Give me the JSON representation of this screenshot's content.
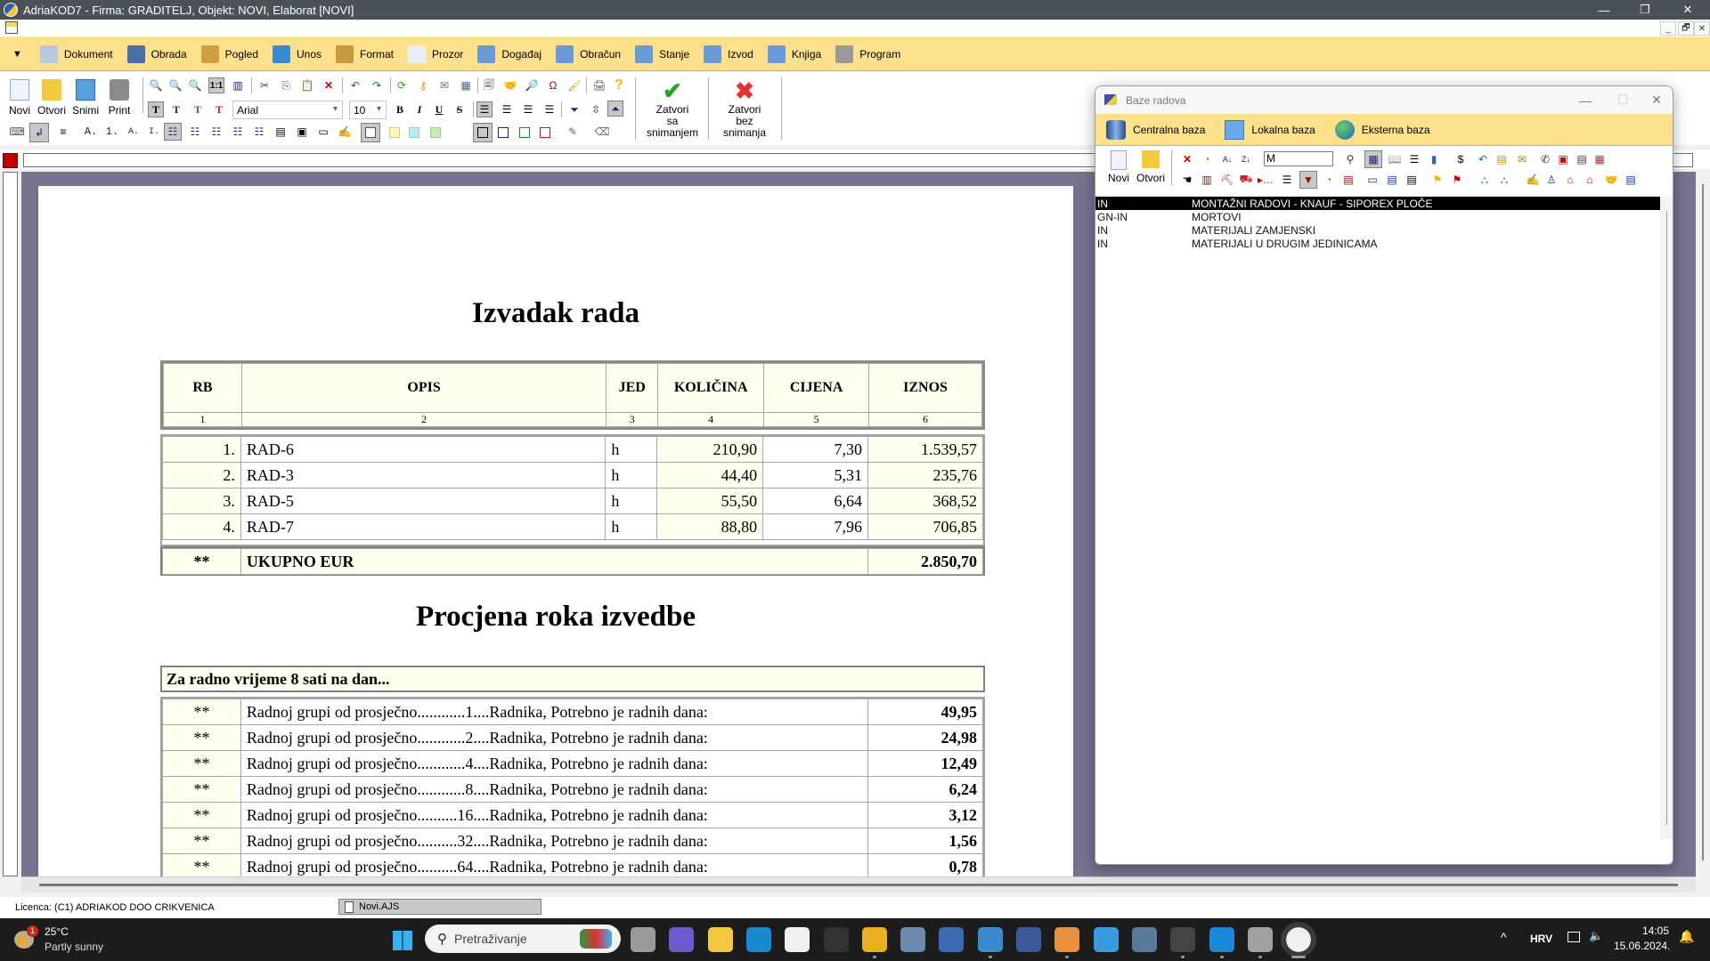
{
  "window": {
    "title": "AdriaKOD7 - Firma: GRADITELJ,   Objekt: NOVI,  Elaborat [NOVI]",
    "minimize": "—",
    "restore": "❐",
    "close": "✕",
    "mdi_min": "_",
    "mdi_restore": "🗗",
    "mdi_close": "✕"
  },
  "menu": {
    "dropdown": "▼",
    "items": [
      {
        "label": "Dokument",
        "icon": "document-icon",
        "color": "#b8c8e0"
      },
      {
        "label": "Obrada",
        "icon": "tools-icon",
        "color": "#4a6fa5"
      },
      {
        "label": "Pogled",
        "icon": "magnifier-icon",
        "color": "#d0a040"
      },
      {
        "label": "Unos",
        "icon": "arrow-icon",
        "color": "#3a8ad0"
      },
      {
        "label": "Format",
        "icon": "brush-icon",
        "color": "#c89a40"
      },
      {
        "label": "Prozor",
        "icon": "window-icon",
        "color": "#e8eef8"
      },
      {
        "label": "Događaj",
        "icon": "grid-icon",
        "color": "#6a9ad8"
      },
      {
        "label": "Obračun",
        "icon": "grid-icon",
        "color": "#6a9ad8"
      },
      {
        "label": "Stanje",
        "icon": "grid-icon",
        "color": "#6a9ad8"
      },
      {
        "label": "Izvod",
        "icon": "grid-icon",
        "color": "#6a9ad8"
      },
      {
        "label": "Knjiga",
        "icon": "grid-icon",
        "color": "#6a9ad8"
      },
      {
        "label": "Program",
        "icon": "gear-icon",
        "color": "#9a9a9a"
      }
    ]
  },
  "toolbar": {
    "novi": "Novi",
    "otvori": "Otvori",
    "snimi": "Snimi",
    "print": "Print",
    "zoom_1_1": "1:1",
    "font_name": "Arial",
    "font_size": "10",
    "bold": "B",
    "italic": "I",
    "underline": "U",
    "strike": "S",
    "t_label": "T",
    "save_close_line1": "Zatvori",
    "save_close_line2": "sa snimanjem",
    "nosave_close_line1": "Zatvori",
    "nosave_close_line2": "bez snimanja",
    "check_glyph": "✔",
    "x_glyph": "✖",
    "list_labels": [
      "A.",
      "1.",
      "A.",
      "I."
    ]
  },
  "document": {
    "title1": "Izvadak rada",
    "table1": {
      "headers": [
        "RB",
        "OPIS",
        "JED",
        "KOLIČINA",
        "CIJENA",
        "IZNOS"
      ],
      "col_numbers": [
        "1",
        "2",
        "3",
        "4",
        "5",
        "6"
      ],
      "rows": [
        {
          "rb": "1.",
          "opis": "RAD-6",
          "jed": "h",
          "kolicina": "210,90",
          "cijena": "7,30",
          "iznos": "1.539,57"
        },
        {
          "rb": "2.",
          "opis": "RAD-3",
          "jed": "h",
          "kolicina": "44,40",
          "cijena": "5,31",
          "iznos": "235,76"
        },
        {
          "rb": "3.",
          "opis": "RAD-5",
          "jed": "h",
          "kolicina": "55,50",
          "cijena": "6,64",
          "iznos": "368,52"
        },
        {
          "rb": "4.",
          "opis": "RAD-7",
          "jed": "h",
          "kolicina": "88,80",
          "cijena": "7,96",
          "iznos": "706,85"
        }
      ],
      "total": {
        "mark": "**",
        "label": "UKUPNO EUR",
        "value": "2.850,70"
      }
    },
    "title2": "Procjena roka izvedbe",
    "table2": {
      "header": "Za radno vrijeme 8 sati na dan...",
      "rows": [
        {
          "mark": "**",
          "text": "Radnoj grupi od prosječno............1....Radnika, Potrebno je radnih dana:",
          "value": "49,95"
        },
        {
          "mark": "**",
          "text": "Radnoj grupi od prosječno............2....Radnika, Potrebno je radnih dana:",
          "value": "24,98"
        },
        {
          "mark": "**",
          "text": "Radnoj grupi od prosječno............4....Radnika, Potrebno je radnih dana:",
          "value": "12,49"
        },
        {
          "mark": "**",
          "text": "Radnoj grupi od prosječno............8....Radnika, Potrebno je radnih dana:",
          "value": "6,24"
        },
        {
          "mark": "**",
          "text": "Radnoj grupi od prosječno..........16....Radnika, Potrebno je radnih dana:",
          "value": "3,12"
        },
        {
          "mark": "**",
          "text": "Radnoj grupi od prosječno..........32....Radnika, Potrebno je radnih dana:",
          "value": "1,56"
        },
        {
          "mark": "**",
          "text": "Radnoj grupi od prosječno..........64....Radnika, Potrebno je radnih dana:",
          "value": "0,78"
        }
      ]
    }
  },
  "panel": {
    "title": "Baze radova",
    "minimize": "—",
    "maximize": "☐",
    "close": "✕",
    "tabs": [
      {
        "label": "Centralna baza",
        "icon": "database-icon"
      },
      {
        "label": "Lokalna baza",
        "icon": "floppy-icon"
      },
      {
        "label": "Eksterna baza",
        "icon": "globe-icon"
      }
    ],
    "novi": "Novi",
    "otvori": "Otvori",
    "search_value": "M",
    "dollar": "$",
    "list": [
      {
        "code": "IN",
        "name": "MONTAŽNI RADOVI - KNAUF - SIPOREX PLOČE",
        "selected": true
      },
      {
        "code": "GN-IN",
        "name": "MORTOVI",
        "selected": false
      },
      {
        "code": "IN",
        "name": "MATERIJALI ZAMJENSKI",
        "selected": false
      },
      {
        "code": "IN",
        "name": "MATERIJALI U DRUGIM JEDINICAMA",
        "selected": false
      }
    ]
  },
  "statusbar": {
    "license": "Licenca:  (C1) ADRIAKOD DOO CRIKVENICA",
    "doc_tab": "Novi.AJS"
  },
  "taskbar": {
    "weather_temp": "25°C",
    "weather_desc": "Partly sunny",
    "weather_badge": "1",
    "search_placeholder": "Pretraživanje",
    "language": "HRV",
    "time": "14:05",
    "date": "15.06.2024.",
    "chevron": "^"
  }
}
